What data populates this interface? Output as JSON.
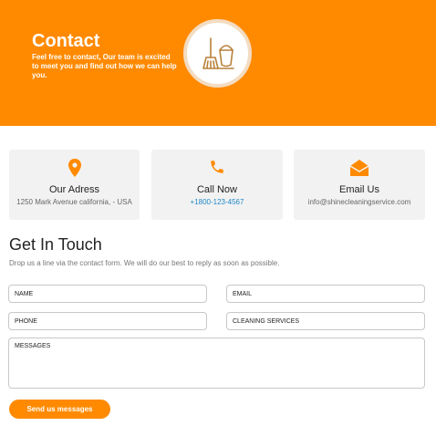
{
  "colors": {
    "accent": "#ff8a00",
    "link": "#1e88c9",
    "card_bg": "#f2f2f2"
  },
  "hero": {
    "title": "Contact",
    "text": "Feel free to contact, Our team is excited to meet you and find out how we can help you.",
    "badge_icon": "broom-bucket-icon"
  },
  "cards": [
    {
      "icon": "map-pin-icon",
      "title": "Our Adress",
      "sub": "1250 Mark Avenue california, - USA"
    },
    {
      "icon": "phone-icon",
      "title": "Call Now",
      "sub": "+1800-123-4567"
    },
    {
      "icon": "envelope-open-icon",
      "title": "Email Us",
      "sub": "info@shinecleaningservice.com"
    }
  ],
  "form": {
    "title": "Get In Touch",
    "subtitle": "Drop us a line via the contact form. We will do our best to reply as soon as possible.",
    "name_placeholder": "NAME",
    "email_placeholder": "EMAIL",
    "phone_placeholder": "PHONE",
    "service_value": "CLEANING SERVICES",
    "messages_placeholder": "MESSAGES",
    "submit_label": "Send us messages"
  }
}
